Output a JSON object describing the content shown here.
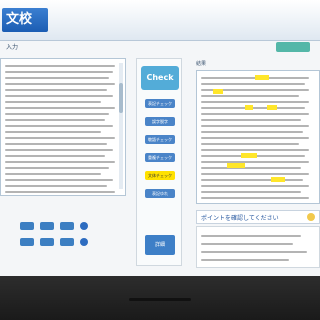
{
  "app": {
    "title": "文校"
  },
  "header": {
    "hint_left": "入力",
    "hint_right": "結果"
  },
  "middle": {
    "check_label": "Check",
    "feature_buttons": [
      "表記チェック",
      "誤字脱字",
      "敬語チェック",
      "重複チェック",
      "文体チェック",
      "表記ゆれ"
    ],
    "bottom_label": "詳細"
  },
  "right": {
    "toolbar_text": "ポイントを確認してください"
  }
}
